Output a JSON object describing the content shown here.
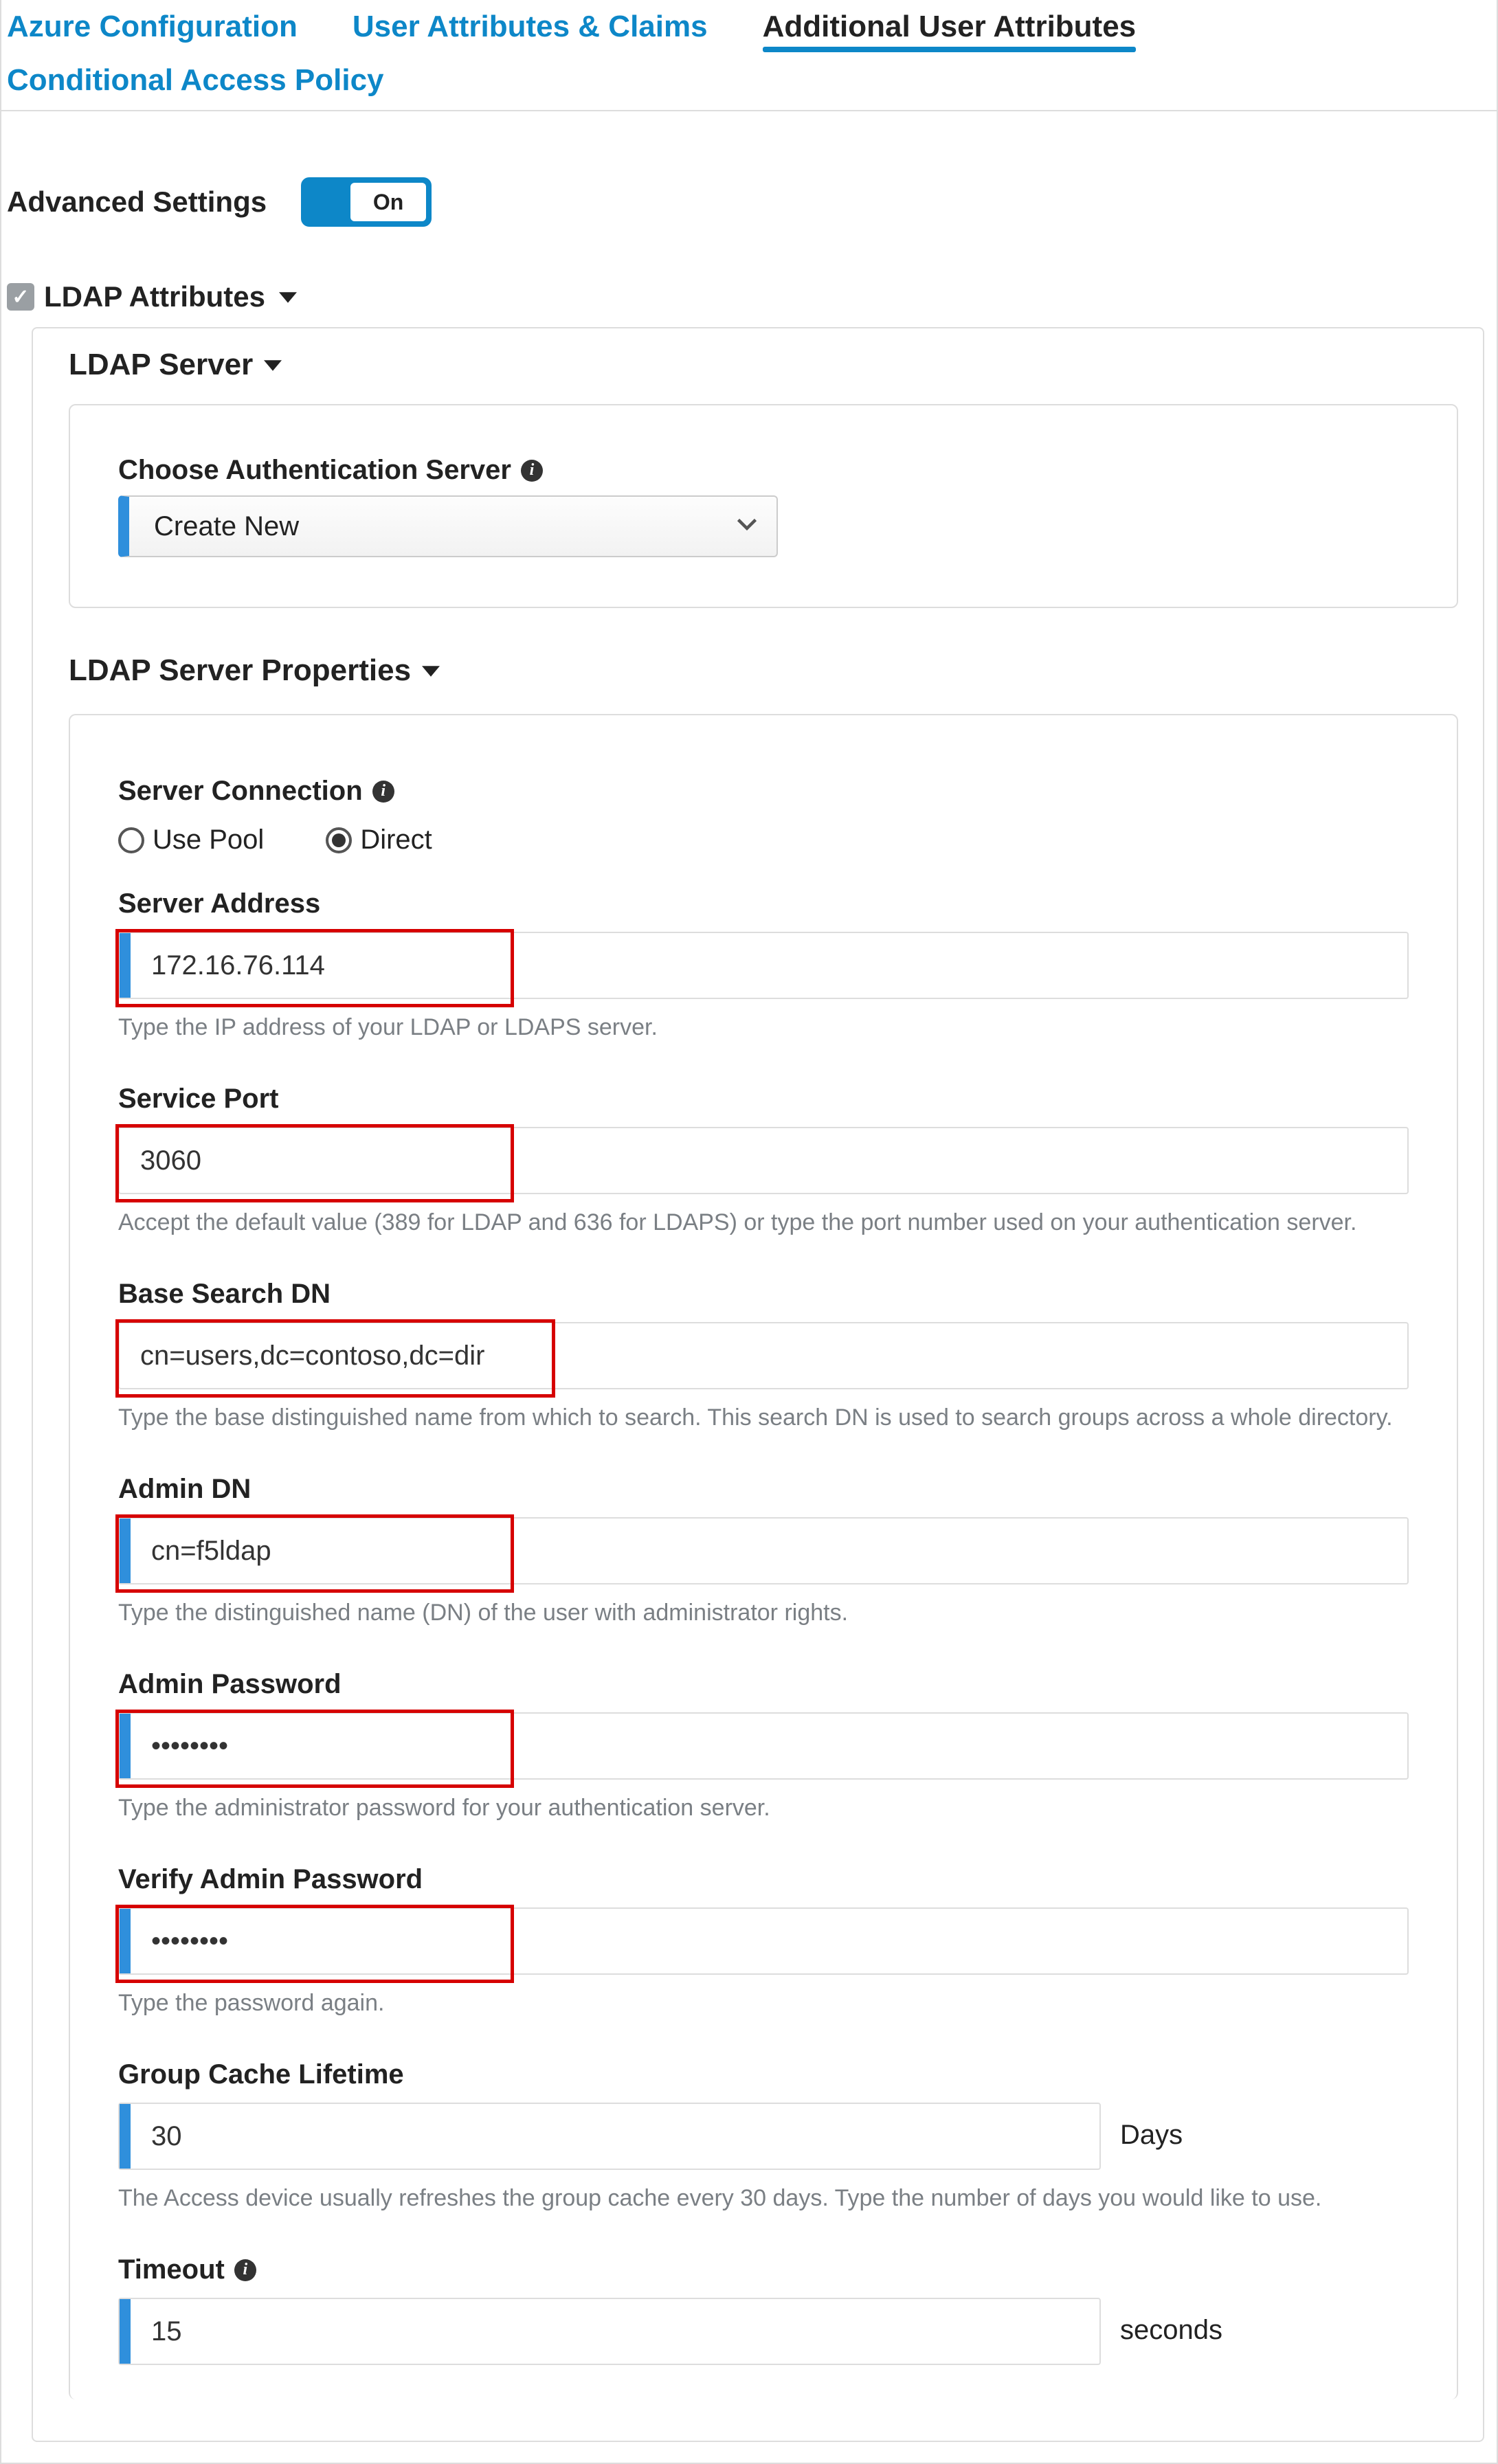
{
  "tabs": {
    "azure": "Azure Configuration",
    "claims": "User Attributes & Claims",
    "additional": "Additional User Attributes",
    "policy": "Conditional Access Policy"
  },
  "advanced": {
    "label": "Advanced Settings",
    "toggle": "On"
  },
  "ldap": {
    "section": "LDAP Attributes",
    "server_title": "LDAP Server",
    "auth_label": "Choose Authentication Server",
    "auth_value": "Create New",
    "props_title": "LDAP Server Properties",
    "conn_label": "Server Connection",
    "conn_pool": "Use Pool",
    "conn_direct": "Direct",
    "addr_label": "Server Address",
    "addr_value": "172.16.76.114",
    "addr_help": "Type the IP address of your LDAP or LDAPS server.",
    "port_label": "Service Port",
    "port_value": "3060",
    "port_help": "Accept the default value (389 for LDAP and 636 for LDAPS) or type the port number used on your authentication server.",
    "base_label": "Base Search DN",
    "base_value": "cn=users,dc=contoso,dc=dir",
    "base_help": "Type the base distinguished name from which to search. This search DN is used to search groups across a whole directory.",
    "admindn_label": "Admin DN",
    "admindn_value": "cn=f5ldap",
    "admindn_help": "Type the distinguished name (DN) of the user with administrator rights.",
    "pwd_label": "Admin Password",
    "pwd_value": "••••••••",
    "pwd_help": "Type the administrator password for your authentication server.",
    "vpwd_label": "Verify Admin Password",
    "vpwd_value": "••••••••",
    "vpwd_help": "Type the password again.",
    "cache_label": "Group Cache Lifetime",
    "cache_value": "30",
    "cache_unit": "Days",
    "cache_help": "The Access device usually refreshes the group cache every 30 days. Type the number of days you would like to use.",
    "timeout_label": "Timeout",
    "timeout_value": "15",
    "timeout_unit": "seconds"
  }
}
